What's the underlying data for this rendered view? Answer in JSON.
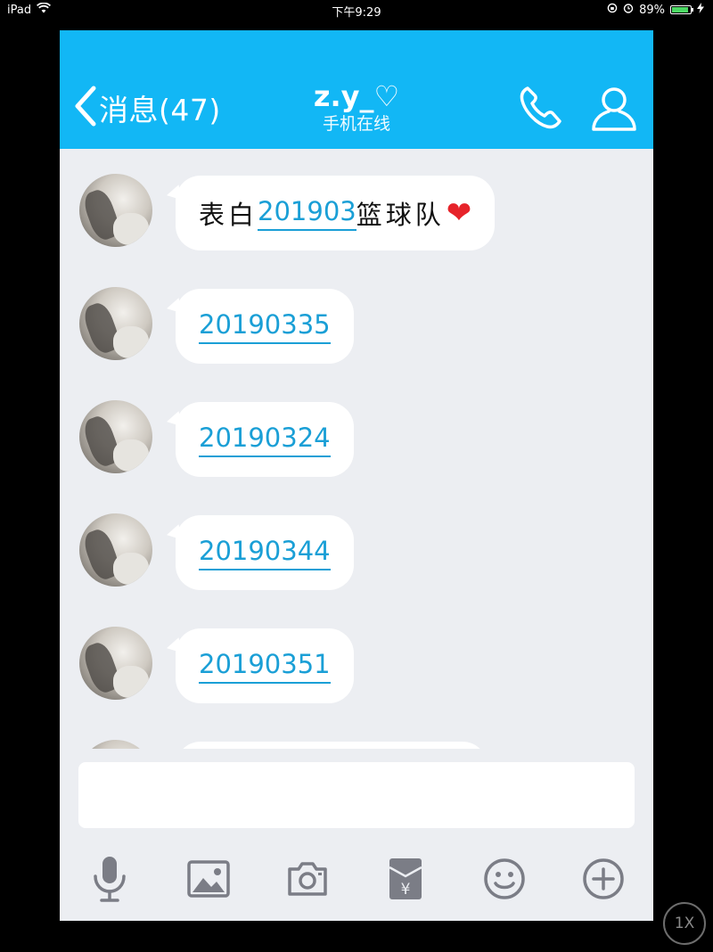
{
  "status_bar": {
    "device": "iPad",
    "time": "下午9:29",
    "battery": "89%",
    "battery_level": 0.89
  },
  "navbar": {
    "back_label": "消息(47)",
    "contact_name": "z.y_♡",
    "contact_status": "手机在线",
    "icons": [
      "back-chevron-icon",
      "phone-icon",
      "profile-icon"
    ],
    "accent": "#12b7f5"
  },
  "messages": [
    {
      "prefix": "表白",
      "number": "201903",
      "suffix": "篮球队",
      "emoji": "❤"
    },
    {
      "number": "20190335"
    },
    {
      "number": "20190324"
    },
    {
      "number": "20190344"
    },
    {
      "number": "20190351"
    }
  ],
  "input": {
    "value": ""
  },
  "toolbar_icons": [
    "microphone-icon",
    "image-icon",
    "camera-icon",
    "red-packet-icon",
    "emoji-icon",
    "plus-icon"
  ],
  "zoom_button": "1X"
}
